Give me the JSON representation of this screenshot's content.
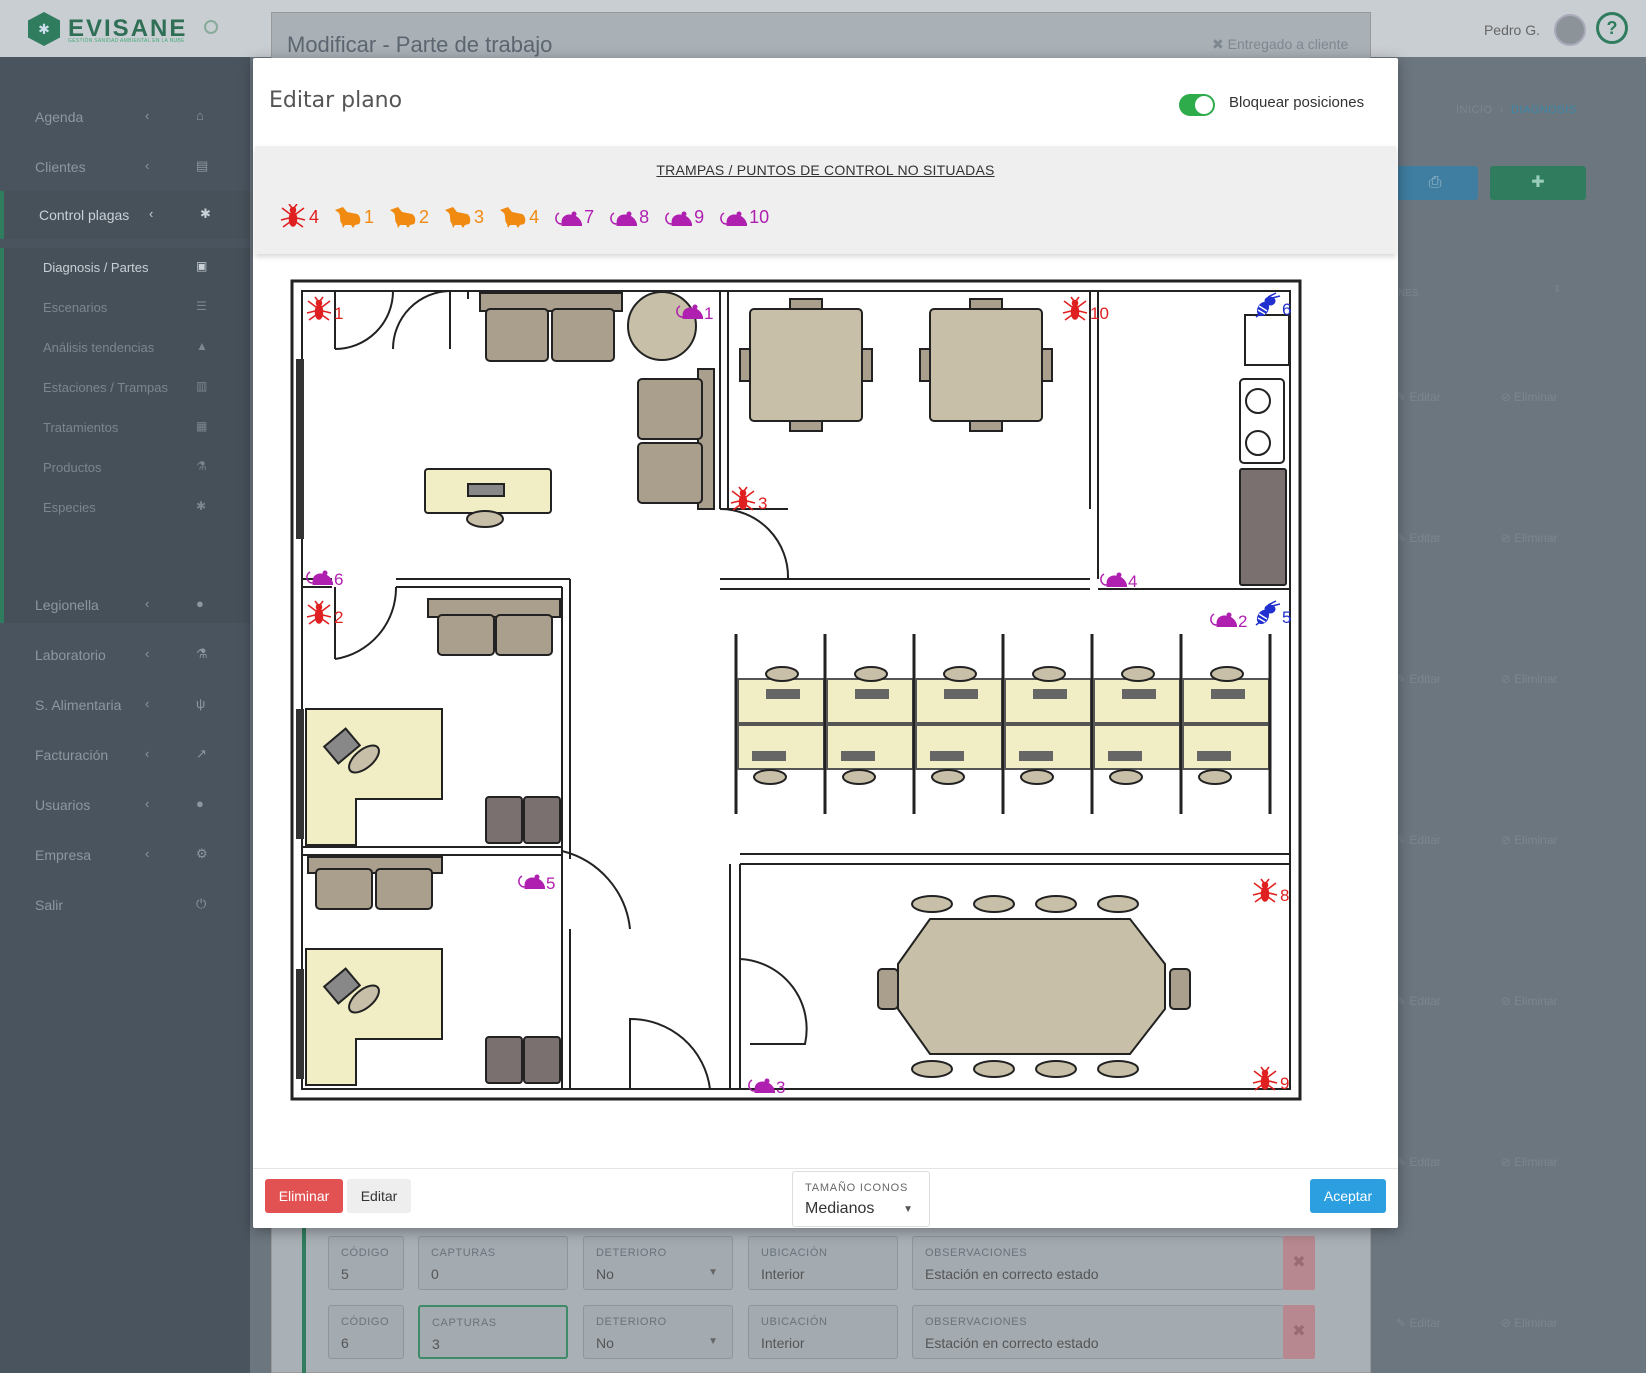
{
  "header": {
    "brand": "EVISANE",
    "tagline": "GESTIÓN SANIDAD AMBIENTAL EN LA NUBE",
    "user_name": "Pedro G.",
    "help_label": "?"
  },
  "sidebar": {
    "items": [
      {
        "label": "Agenda",
        "icon": "home-icon"
      },
      {
        "label": "Clientes",
        "icon": "id-card-icon"
      },
      {
        "label": "Control plagas",
        "icon": "bug-icon"
      },
      {
        "label": "Legionella",
        "icon": "drop-icon"
      },
      {
        "label": "Laboratorio",
        "icon": "flask-icon"
      },
      {
        "label": "S. Alimentaria",
        "icon": "cutlery-icon"
      },
      {
        "label": "Facturación",
        "icon": "chart-icon"
      },
      {
        "label": "Usuarios",
        "icon": "user-icon"
      },
      {
        "label": "Empresa",
        "icon": "gear-icon"
      },
      {
        "label": "Salir",
        "icon": "power-icon"
      }
    ],
    "subitems": [
      {
        "label": "Diagnosis / Partes",
        "icon": "clipboard-icon"
      },
      {
        "label": "Escenarios",
        "icon": "list-icon"
      },
      {
        "label": "Análisis tendencias",
        "icon": "area-chart-icon"
      },
      {
        "label": "Estaciones / Trampas",
        "icon": "trash-icon"
      },
      {
        "label": "Tratamientos",
        "icon": "briefcase-icon"
      },
      {
        "label": "Productos",
        "icon": "flask-icon"
      },
      {
        "label": "Especies",
        "icon": "bug-icon"
      }
    ]
  },
  "background": {
    "panel_title": "Modificar - Parte de trabajo",
    "delivered_label": "Entregado a cliente",
    "breadcrumb": [
      "INICIO",
      "DIAGNOSIS"
    ],
    "row_actions": {
      "edit": "Editar",
      "delete": "Eliminar"
    },
    "station_rows": [
      {
        "codigo": "5",
        "capturas": "0",
        "deterioro": "No",
        "ubicacion": "Interior",
        "observaciones": "Estación en correcto estado"
      },
      {
        "codigo": "6",
        "capturas": "3",
        "deterioro": "No",
        "ubicacion": "Interior",
        "observaciones": "Estación en correcto estado"
      }
    ],
    "field_labels": {
      "codigo": "CÓDIGO",
      "capturas": "CAPTURAS",
      "deterioro": "DETERIORO",
      "ubicacion": "UBICACIÓN",
      "observaciones": "OBSERVACIONES"
    },
    "column_fragment": "NES"
  },
  "modal": {
    "title": "Editar plano",
    "lock_label": "Bloquear posiciones",
    "lock_on": true,
    "unplaced_title": "TRAMPAS / PUNTOS DE CONTROL NO SITUADAS",
    "unplaced": [
      {
        "type": "insect",
        "num": "4",
        "color": "#e02020"
      },
      {
        "type": "rat",
        "num": "1",
        "color": "#f08a10"
      },
      {
        "type": "rat",
        "num": "2",
        "color": "#f08a10"
      },
      {
        "type": "rat",
        "num": "3",
        "color": "#f08a10"
      },
      {
        "type": "rat",
        "num": "4",
        "color": "#f08a10"
      },
      {
        "type": "mouse",
        "num": "7",
        "color": "#b020b0"
      },
      {
        "type": "mouse",
        "num": "8",
        "color": "#b020b0"
      },
      {
        "type": "mouse",
        "num": "9",
        "color": "#b020b0"
      },
      {
        "type": "mouse",
        "num": "10",
        "color": "#b020b0"
      }
    ],
    "placed": [
      {
        "type": "insect",
        "num": "1",
        "color": "#e02020"
      },
      {
        "type": "insect",
        "num": "2",
        "color": "#e02020"
      },
      {
        "type": "insect",
        "num": "3",
        "color": "#e02020"
      },
      {
        "type": "insect",
        "num": "10",
        "color": "#e02020"
      },
      {
        "type": "insect",
        "num": "8",
        "color": "#e02020"
      },
      {
        "type": "insect",
        "num": "9",
        "color": "#e02020"
      },
      {
        "type": "mouse",
        "num": "1",
        "color": "#b020b0"
      },
      {
        "type": "mouse",
        "num": "6",
        "color": "#b020b0"
      },
      {
        "type": "mouse",
        "num": "4",
        "color": "#b020b0"
      },
      {
        "type": "mouse",
        "num": "2",
        "color": "#b020b0"
      },
      {
        "type": "mouse",
        "num": "5",
        "color": "#b020b0"
      },
      {
        "type": "mouse",
        "num": "3",
        "color": "#b020b0"
      },
      {
        "type": "wasp",
        "num": "6",
        "color": "#2030d0"
      },
      {
        "type": "wasp",
        "num": "5",
        "color": "#2030d0"
      }
    ],
    "footer": {
      "delete_label": "Eliminar",
      "edit_label": "Editar",
      "size_label": "TAMAÑO ICONOS",
      "size_value": "Medianos",
      "accept_label": "Aceptar"
    }
  }
}
